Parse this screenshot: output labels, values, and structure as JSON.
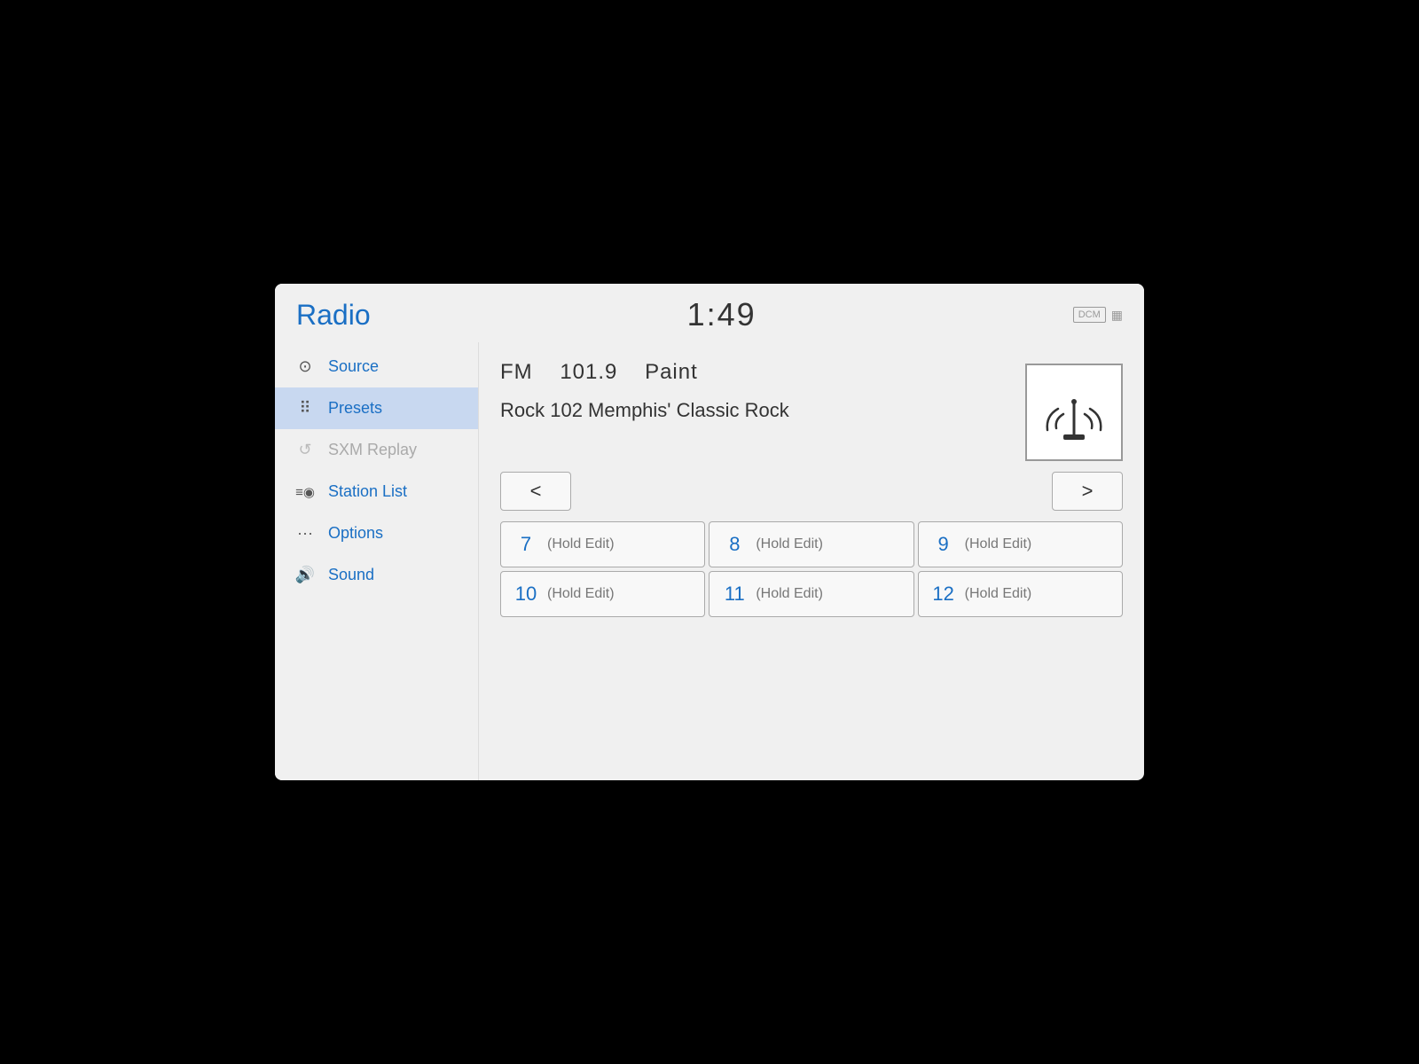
{
  "header": {
    "title": "Radio",
    "time": "1:49",
    "dcm_badge": "DCM",
    "wifi_label": "wifi"
  },
  "sidebar": {
    "items": [
      {
        "id": "source",
        "label": "Source",
        "icon": "⊙□",
        "active": false,
        "disabled": false
      },
      {
        "id": "presets",
        "label": "Presets",
        "icon": "⠿",
        "active": true,
        "disabled": false
      },
      {
        "id": "sxm-replay",
        "label": "SXM Replay",
        "icon": "↺",
        "active": false,
        "disabled": true
      },
      {
        "id": "station-list",
        "label": "Station List",
        "icon": "≡◉",
        "active": false,
        "disabled": false
      },
      {
        "id": "options",
        "label": "Options",
        "icon": "···",
        "active": false,
        "disabled": false
      },
      {
        "id": "sound",
        "label": "Sound",
        "icon": "◁))",
        "active": false,
        "disabled": false
      }
    ]
  },
  "content": {
    "band": "FM",
    "frequency": "101.9",
    "genre": "Paint",
    "station_name": "Rock 102 Memphis' Classic Rock",
    "prev_btn": "<",
    "next_btn": ">",
    "presets": [
      {
        "number": "7",
        "label": "(Hold Edit)"
      },
      {
        "number": "8",
        "label": "(Hold Edit)"
      },
      {
        "number": "9",
        "label": "(Hold Edit)"
      },
      {
        "number": "10",
        "label": "(Hold Edit)"
      },
      {
        "number": "11",
        "label": "(Hold Edit)"
      },
      {
        "number": "12",
        "label": "(Hold Edit)"
      }
    ]
  }
}
